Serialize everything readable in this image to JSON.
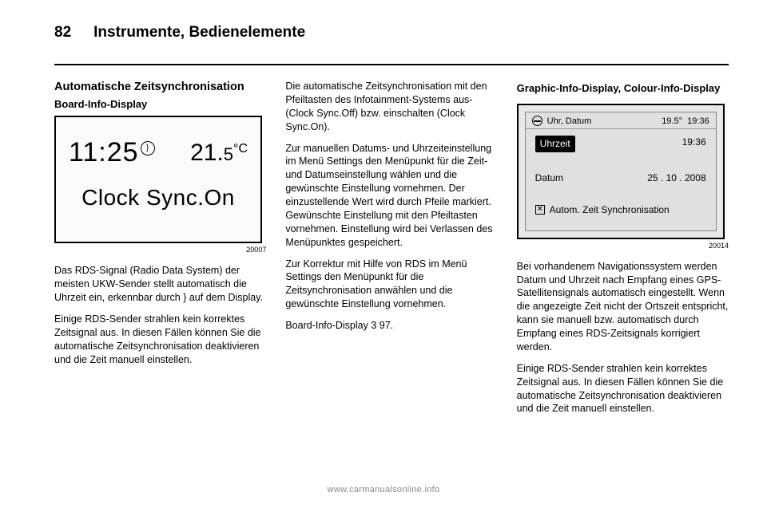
{
  "header": {
    "page_number": "82",
    "chapter": "Instrumente, Bedienelemente"
  },
  "col1": {
    "heading1": "Automatische Zeitsynchronisation",
    "heading2": "Board-Info-Display",
    "fig1": {
      "time": "11:25",
      "temp_whole": "21.",
      "temp_frac": "5",
      "temp_unit": "°C",
      "center_text": "Clock Sync.On",
      "figure_number": "20007"
    },
    "p1": "Das RDS-Signal (Radio Data System) der meisten UKW-Sender stellt automatisch die Uhrzeit ein, erkennbar durch } auf dem Display.",
    "p2": "Einige RDS-Sender strahlen kein korrektes Zeitsignal aus. In diesen Fällen können Sie die automatische Zeitsynchronisation deaktivieren und die Zeit manuell einstellen."
  },
  "col2": {
    "p1": "Die automatische Zeitsynchronisation mit den Pfeiltasten des Infotainment-Systems aus- (Clock Sync.Off) bzw. einschalten (Clock Sync.On).",
    "p2": "Zur manuellen Datums- und Uhrzeiteinstellung im Menü Settings den Menüpunkt für die Zeit- und Datumseinstellung wählen und die gewünschte Einstellung vornehmen. Der einzustellende Wert wird durch Pfeile markiert. Gewünschte Einstellung mit den Pfeiltasten vornehmen. Einstellung wird bei Verlassen des Menüpunktes gespeichert.",
    "p3": "Zur Korrektur mit Hilfe von RDS im Menü Settings den Menüpunkt für die Zeitsynchronisation anwählen und die gewünschte Einstellung vornehmen.",
    "p4_pre": "Board-Info-Display ",
    "p4_ref": "3 97",
    "p4_post": "."
  },
  "col3": {
    "heading": "Graphic-Info-Display, Colour-Info-Display",
    "fig2": {
      "title": "Uhr, Datum",
      "temp": "19.5°",
      "time": "19:36",
      "row1_label": "Uhrzeit",
      "row1_value": "19:36",
      "row2_label": "Datum",
      "row2_value": "25 . 10 . 2008",
      "row3_label": "Autom. Zeit Synchronisation",
      "figure_number": "20014"
    },
    "p1": "Bei vorhandenem Navigationssystem werden Datum und Uhrzeit nach Empfang eines GPS-Satellitensignals automatisch eingestellt. Wenn die angezeigte Zeit nicht der Ortszeit entspricht, kann sie manuell bzw. automatisch durch Empfang eines RDS-Zeitsignals korrigiert werden.",
    "p2": "Einige RDS-Sender strahlen kein korrektes Zeitsignal aus. In diesen Fällen können Sie die automatische Zeitsynchronisation deaktivieren und die Zeit manuell einstellen."
  },
  "footer": "www.carmanualsonline.info"
}
